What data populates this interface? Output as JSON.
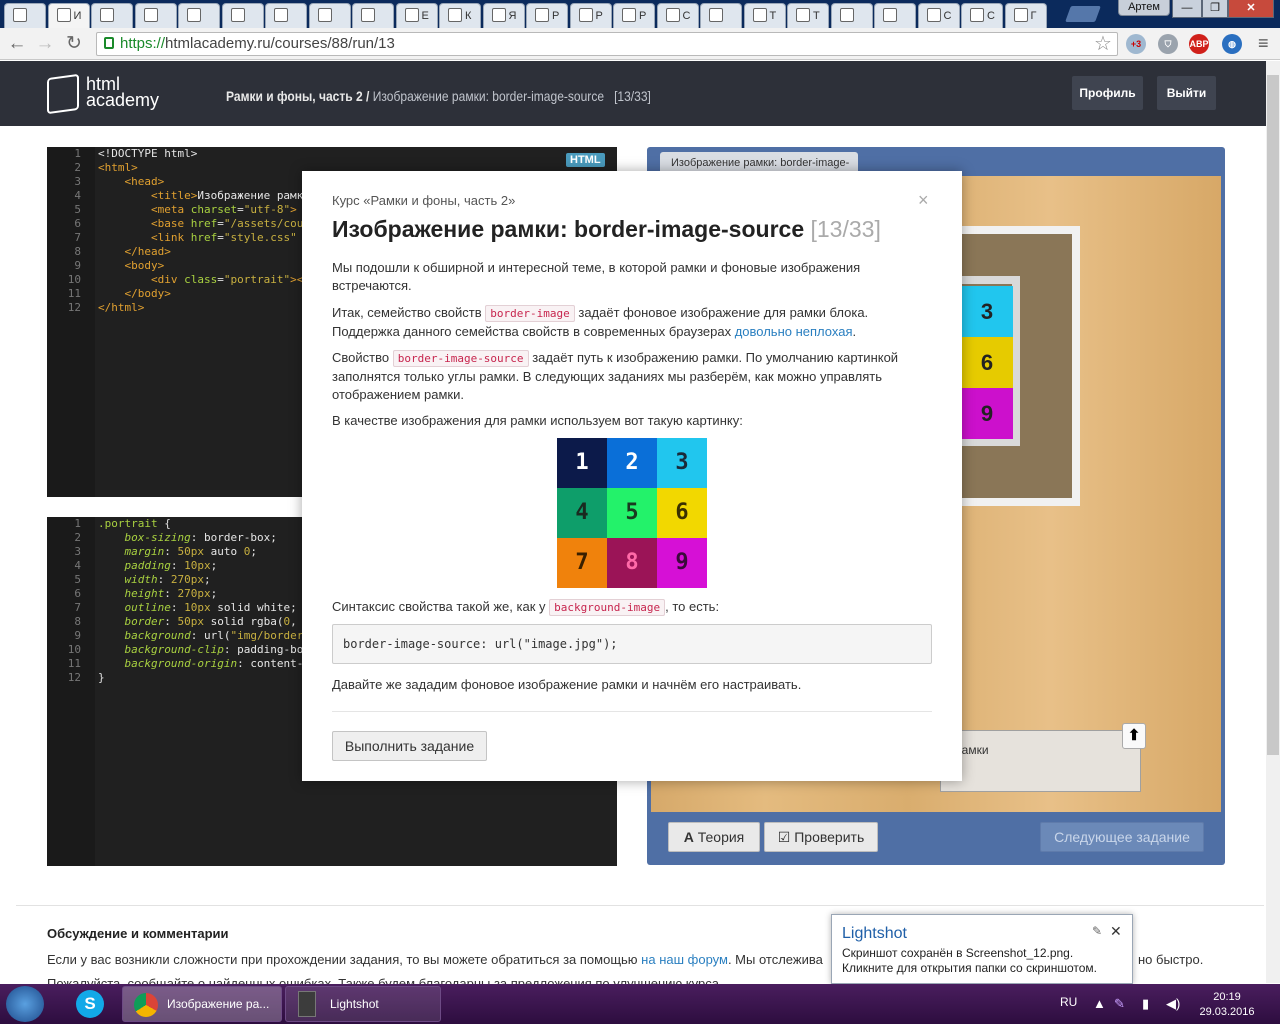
{
  "browser": {
    "tabs": [
      "",
      "И",
      "",
      "",
      "",
      "",
      "",
      "",
      "",
      "Е",
      "К",
      "Я",
      "Р",
      "Р",
      "Р",
      "С",
      "",
      "Т",
      "Т",
      "",
      "",
      "С",
      "С",
      "Г"
    ],
    "user": "Артем",
    "window_controls": [
      "—",
      "❐",
      "✕"
    ],
    "url_scheme": "https://",
    "url_rest": "htmlacademy.ru/courses/88/run/13",
    "badge_count": "+3",
    "adblock": "ABP"
  },
  "site": {
    "logo_line1": "html",
    "logo_line2": "academy",
    "breadcrumb_course": "Рамки и фоны, часть 2 /",
    "breadcrumb_lesson": "Изображение рамки: border-image-source",
    "breadcrumb_progress": "[13/33]",
    "profile_btn": "Профиль",
    "logout_btn": "Выйти"
  },
  "html_editor": {
    "label": "HTML",
    "lines": [
      "1",
      "2",
      "3",
      "4",
      "5",
      "6",
      "7",
      "8",
      "9",
      "10",
      "11",
      "12"
    ]
  },
  "css_editor": {
    "lines": [
      "1",
      "2",
      "3",
      "4",
      "5",
      "6",
      "7",
      "8",
      "9",
      "10",
      "11",
      "12"
    ]
  },
  "result": {
    "tab_title": "Изображение рамки: border-image-",
    "task_text": "е рамки",
    "up_arrow": "⬆",
    "theory_btn": "Теория",
    "theory_icon": "A",
    "check_btn": "Проверить",
    "check_icon": "☑",
    "next_btn": "Следующее задание",
    "preview_tiles": [
      "3",
      "6",
      "9"
    ]
  },
  "modal": {
    "close": "×",
    "course": "Курс «Рамки и фоны, часть 2»",
    "title": "Изображение рамки: border-image-source",
    "progress": "[13/33]",
    "p1": "Мы подошли к обширной и интересной теме, в которой рамки и фоновые изображения встречаются.",
    "p2_a": "Итак, семейство свойств",
    "p2_code": "border-image",
    "p2_b": "задаёт фоновое изображение для рамки блока. Поддержка данного семейства свойств в современных браузерах",
    "p2_link": "довольно неплохая",
    "p2_c": ".",
    "p3_a": "Свойство",
    "p3_code": "border-image-source",
    "p3_b": "задаёт путь к изображению рамки. По умолчанию картинкой заполнятся только углы рамки. В следующих заданиях мы разберём, как можно управлять отображением рамки.",
    "p4": "В качестве изображения для рамки используем вот такую картинку:",
    "grid": [
      {
        "n": "1",
        "bg": "#0c1a4a",
        "fg": "#ffffff"
      },
      {
        "n": "2",
        "bg": "#0a6fd8",
        "fg": "#ffffff"
      },
      {
        "n": "3",
        "bg": "#21c6ee",
        "fg": "#1a2a3a"
      },
      {
        "n": "4",
        "bg": "#0e9e6a",
        "fg": "#1a2a20"
      },
      {
        "n": "5",
        "bg": "#23f26a",
        "fg": "#1a3a20"
      },
      {
        "n": "6",
        "bg": "#f2d800",
        "fg": "#3a3000"
      },
      {
        "n": "7",
        "bg": "#f0820c",
        "fg": "#3a2000"
      },
      {
        "n": "8",
        "bg": "#9b1457",
        "fg": "#ff6aa8"
      },
      {
        "n": "9",
        "bg": "#d610d6",
        "fg": "#3a0a3a"
      }
    ],
    "p5_a": "Синтаксис свойства такой же, как у",
    "p5_code": "background-image",
    "p5_b": ", то есть:",
    "code_sample": "border-image-source: url(\"image.jpg\");",
    "p6": "Давайте же зададим фоновое изображение рамки и начнём его настраивать.",
    "do_btn": "Выполнить задание"
  },
  "discussion": {
    "title": "Обсуждение и комментарии",
    "text_a": "Если у вас возникли сложности при прохождении задания, то вы можете обратиться за помощью",
    "text_link": "на наш форум",
    "text_b": ". Мы отслежива",
    "text_end": "но быстро.",
    "text2": "Пожалуйста, сообщайте о найденных ошибках. Также будем благодарны за предложения по улучшению курса."
  },
  "lightshot": {
    "title": "Lightshot",
    "text": "Скриншот сохранён в Screenshot_12.png. Кликните для открытия папки со скриншотом.",
    "close": "✕",
    "pin": "✎"
  },
  "taskbar": {
    "chrome_label": "Изображение ра...",
    "lightshot_label": "Lightshot",
    "skype": "S",
    "lang": "RU",
    "time": "20:19",
    "date": "29.03.2016"
  }
}
